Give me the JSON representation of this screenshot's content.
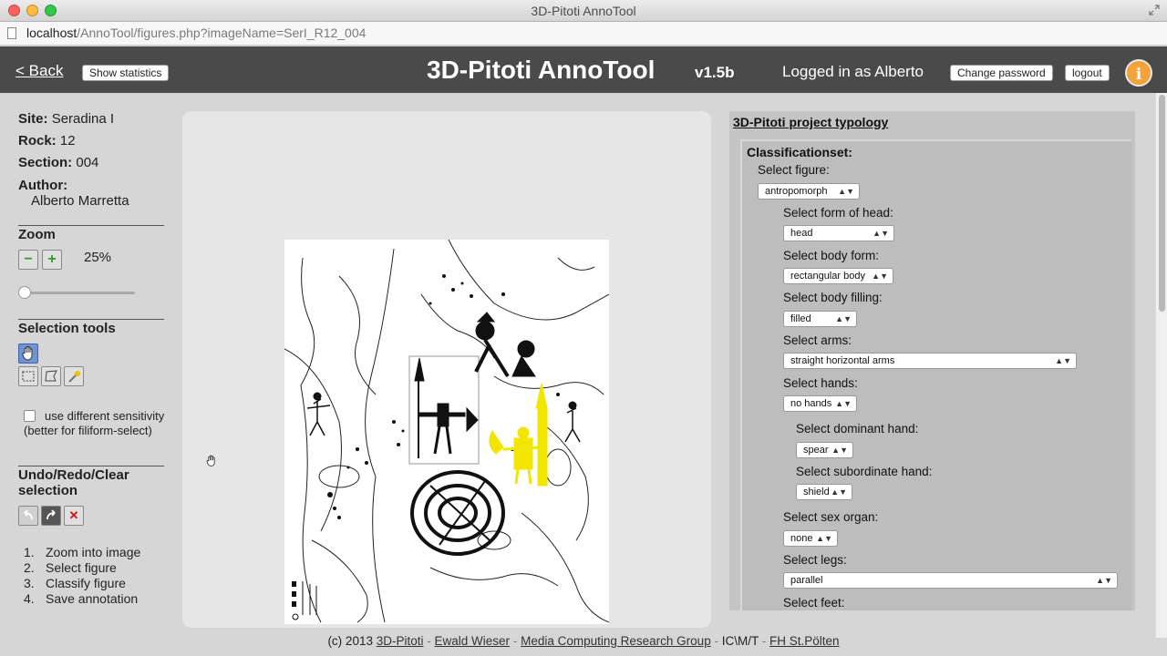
{
  "window": {
    "title": "3D-Pitoti AnnoTool"
  },
  "urlbar": {
    "host": "localhost",
    "path": "/AnnoTool/figures.php?imageName=SerI_R12_004"
  },
  "header": {
    "back_label": "< Back",
    "stats_label": "Show statistics",
    "title": "3D-Pitoti AnnoTool",
    "version": "v1.5b",
    "logged_in": "Logged in as Alberto",
    "change_password_label": "Change password",
    "logout_label": "logout",
    "info_glyph": "i"
  },
  "meta": {
    "site_label": "Site:",
    "site_value": "Seradina I",
    "rock_label": "Rock:",
    "rock_value": "12",
    "section_label": "Section:",
    "section_value": "004",
    "author_label": "Author:",
    "author_value": "Alberto Marretta"
  },
  "zoom": {
    "title": "Zoom",
    "minus": "−",
    "plus": "+",
    "value": "25%",
    "slider_fraction": 0.0
  },
  "selection_tools": {
    "title": "Selection tools",
    "tools": [
      "hand-icon",
      "rect-select-icon",
      "lasso-icon",
      "magic-wand-icon"
    ],
    "sensitivity_text": "use different sensitivity (better for filiform-select)",
    "sensitivity_checked": false
  },
  "undo": {
    "title": "Undo/Redo/Clear selection",
    "clear_glyph": "✕"
  },
  "steps": [
    {
      "num": "1.",
      "text": "Zoom into image"
    },
    {
      "num": "2.",
      "text": "Select figure"
    },
    {
      "num": "3.",
      "text": "Classify figure"
    },
    {
      "num": "4.",
      "text": "Save annotation"
    }
  ],
  "typology": {
    "link": "3D-Pitoti project typology",
    "set_title": "Classificationset:",
    "fields": [
      {
        "label": "Select figure:",
        "value": "antropomorph"
      },
      {
        "label": "Select form of head:",
        "value": "head"
      },
      {
        "label": "Select body form:",
        "value": "rectangular body"
      },
      {
        "label": "Select body filling:",
        "value": "filled"
      },
      {
        "label": "Select arms:",
        "value": "straight horizontal arms"
      },
      {
        "label": "Select hands:",
        "value": "no hands"
      },
      {
        "label": "Select dominant hand:",
        "value": "spear"
      },
      {
        "label": "Select subordinate hand:",
        "value": "shield"
      },
      {
        "label": "Select sex organ:",
        "value": "none"
      },
      {
        "label": "Select legs:",
        "value": "parallel"
      },
      {
        "label": "Select feet:",
        "value": ""
      }
    ]
  },
  "footer": {
    "copyright": "(c) 2013",
    "links": [
      "3D-Pitoti",
      "Ewald Wieser",
      "Media Computing Research Group"
    ],
    "plain": "IC\\M/T",
    "last_link": "FH St.Pölten",
    "separator": "-"
  },
  "colors": {
    "header_bg": "#4a4a4a",
    "accent_orange": "#f3a33a",
    "selection_yellow": "#f2e600"
  }
}
